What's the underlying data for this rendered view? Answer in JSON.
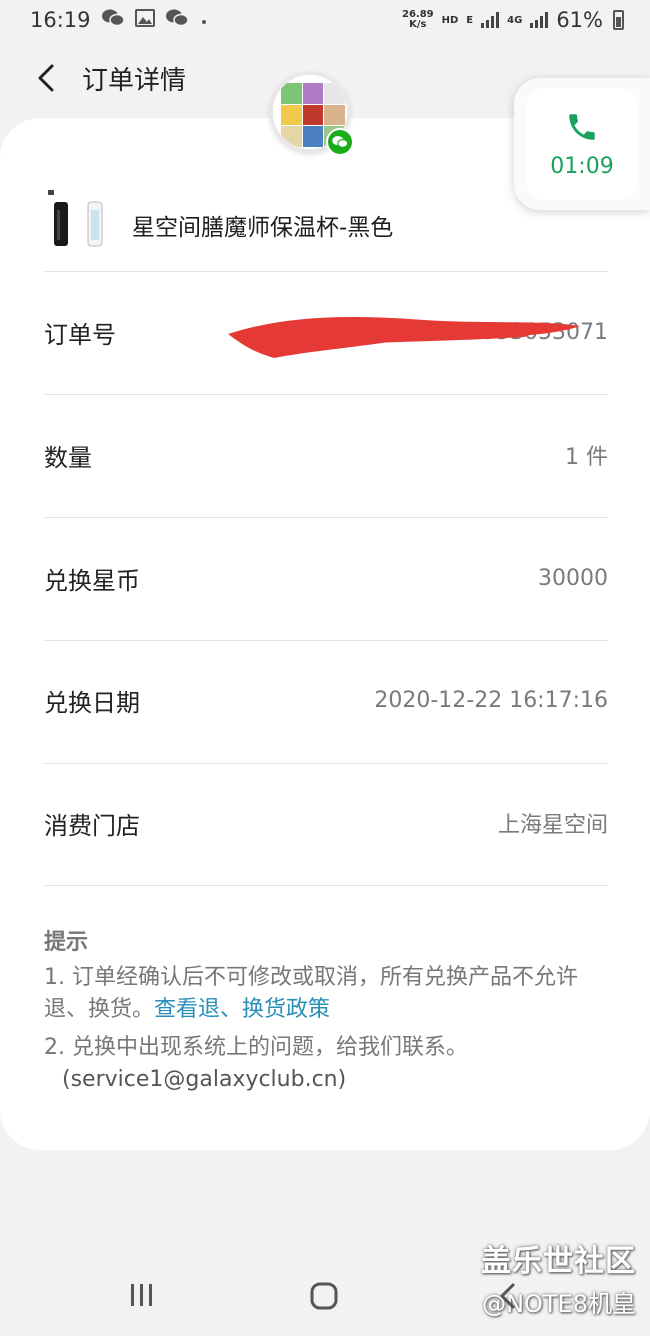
{
  "status_bar": {
    "time": "16:19",
    "net_speed_value": "26.89",
    "net_speed_unit": "K/s",
    "hd": "HD",
    "net_e": "E",
    "net_4g": "4G",
    "battery": "61%"
  },
  "header": {
    "title": "订单详情"
  },
  "call": {
    "duration": "01:09",
    "accent": "#1aa25c"
  },
  "product": {
    "name": "星空间膳魔师保温杯-黑色"
  },
  "rows": [
    {
      "label": "订单号",
      "value": "0353053071"
    },
    {
      "label": "数量",
      "value": "1 件"
    },
    {
      "label": "兑换星币",
      "value": "30000"
    },
    {
      "label": "兑换日期",
      "value": "2020-12-22 16:17:16"
    },
    {
      "label": "消费门店",
      "value": "上海星空间"
    }
  ],
  "tips": {
    "title": "提示",
    "item1_text": "1. 订单经确认后不可修改或取消，所有兑换产品不允许退、换货。",
    "item1_link": "查看退、换货政策",
    "item2_text": "2. 兑换中出现系统上的问题，给我们联系。",
    "item2_email": "(service1@galaxyclub.cn)"
  },
  "watermark": {
    "line1": "盖乐世社区",
    "line2": "@NOTE8机皇"
  },
  "colors": {
    "link": "#2a8fb8",
    "wechat": "#1aad19",
    "redaction": "#e53935"
  }
}
